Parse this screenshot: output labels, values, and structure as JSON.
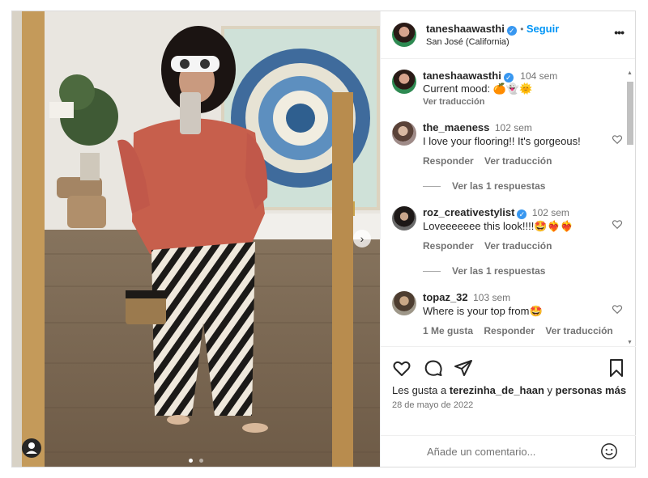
{
  "post": {
    "username": "taneshaawasthi",
    "follow_label": "Seguir",
    "location": "San José (California)",
    "more_label": "•••"
  },
  "caption": {
    "username": "taneshaawasthi",
    "time": "104 sem",
    "text": "Current mood: 🍊👻🌞",
    "translate": "Ver traducción"
  },
  "comments": [
    {
      "username": "the_maeness",
      "time": "102 sem",
      "text": "I love your flooring!! It's gorgeous!",
      "reply": "Responder",
      "translate": "Ver traducción",
      "replies": "Ver las 1 respuestas"
    },
    {
      "username": "roz_creativestylist",
      "verified": true,
      "time": "102 sem",
      "text": "Loveeeeeee this look!!!!🤩❤️‍🔥❤️‍🔥",
      "reply": "Responder",
      "translate": "Ver traducción",
      "replies": "Ver las 1 respuestas"
    },
    {
      "username": "topaz_32",
      "time": "103 sem",
      "text": "Where is your top from🤩",
      "likes": "1 Me gusta",
      "reply": "Responder",
      "translate": "Ver traducción"
    }
  ],
  "likes": {
    "prefix": "Les gusta a",
    "user": "terezinha_de_haan",
    "joiner": "y",
    "suffix": "personas más"
  },
  "date": "28 de mayo de 2022",
  "add_comment": {
    "placeholder": "Añade un comentario..."
  },
  "carousel": {
    "dots": 2,
    "active": 0
  },
  "colors": {
    "blue": "#0095f6",
    "verified": "#3897f0",
    "muted": "#737373"
  }
}
